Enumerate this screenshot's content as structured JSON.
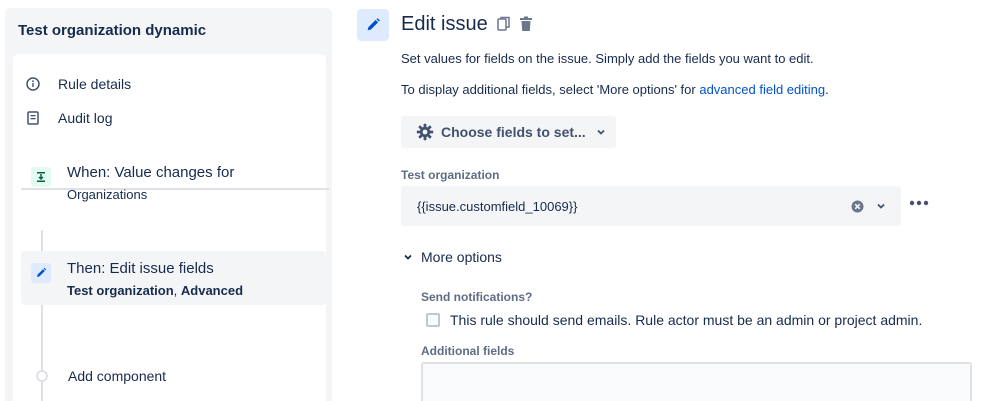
{
  "sidebar": {
    "title": "Test organization dynamic",
    "links": [
      {
        "label": "Rule details",
        "icon": "info-icon"
      },
      {
        "label": "Audit log",
        "icon": "document-icon"
      }
    ],
    "steps": [
      {
        "title": "When: Value changes for",
        "subtitle": "Organizations",
        "icon": "trigger-icon",
        "badge_color": "#e3fcef"
      },
      {
        "title": "Then: Edit issue fields",
        "subtitle_bold_1": "Test organization",
        "subtitle_sep": ", ",
        "subtitle_bold_2": "Advanced",
        "icon": "pencil-icon",
        "badge_color": "#deebff"
      }
    ],
    "add_component": "Add component"
  },
  "main": {
    "title": "Edit issue",
    "desc1": "Set values for fields on the issue. Simply add the fields you want to edit.",
    "desc2_prefix": "To display additional fields, select 'More options' for ",
    "desc2_link": "advanced field editing",
    "desc2_suffix": ".",
    "choose_fields": "Choose fields to set...",
    "field_label": "Test organization",
    "field_value": "{{issue.customfield_10069}}",
    "more_options": "More options",
    "send_notifications_label": "Send notifications?",
    "checkbox_label": "This rule should send emails. Rule actor must be an admin or project admin.",
    "additional_fields_label": "Additional fields"
  },
  "colors": {
    "accent": "#0052cc",
    "sidebar_bg": "#f4f5f7"
  }
}
